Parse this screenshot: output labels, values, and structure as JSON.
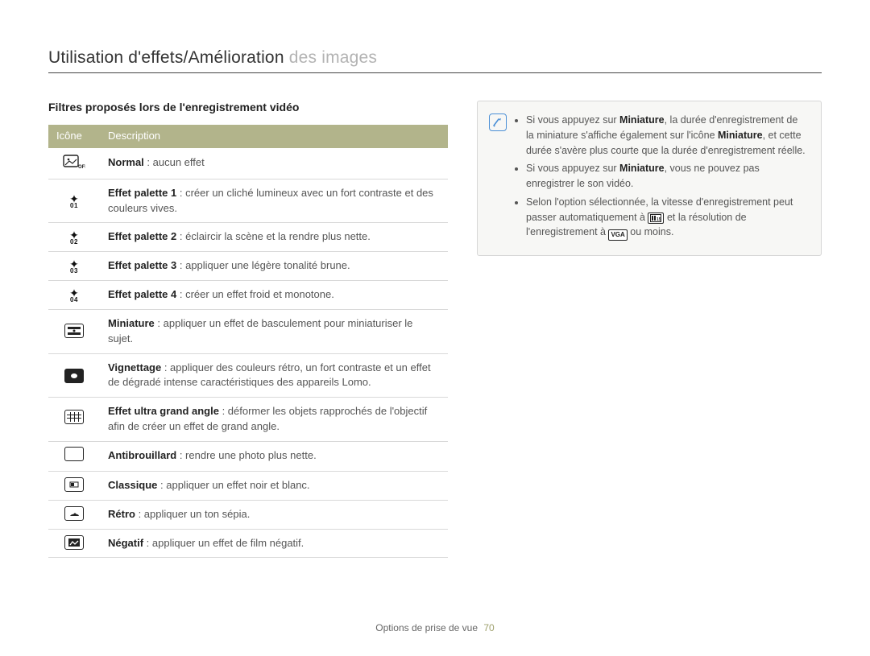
{
  "page_title": {
    "strong": "Utilisation d'effets/Amélioration ",
    "dim": "des images"
  },
  "section_heading": "Filtres proposés lors de l'enregistrement vidéo",
  "table_headers": {
    "icon": "Icône",
    "description": "Description"
  },
  "filters": [
    {
      "icon": "off",
      "bold": "Normal",
      "rest": " : aucun effet"
    },
    {
      "icon": "palette1",
      "bold": "Effet palette 1",
      "rest": " : créer un cliché lumineux avec un fort contraste et des couleurs vives."
    },
    {
      "icon": "palette2",
      "bold": "Effet palette 2",
      "rest": " : éclaircir la scène et la rendre plus nette."
    },
    {
      "icon": "palette3",
      "bold": "Effet palette 3",
      "rest": " : appliquer une légère tonalité brune."
    },
    {
      "icon": "palette4",
      "bold": "Effet palette 4",
      "rest": " : créer un effet froid et monotone."
    },
    {
      "icon": "miniature",
      "bold": "Miniature",
      "rest": " : appliquer un effet de basculement pour miniaturiser le sujet."
    },
    {
      "icon": "vignette",
      "bold": "Vignettage",
      "rest": " : appliquer des couleurs rétro, un fort contraste et un effet de dégradé intense caractéristiques des appareils Lomo."
    },
    {
      "icon": "fisheye",
      "bold": "Effet ultra grand angle",
      "rest": " : déformer les objets rapprochés de l'objectif afin de créer un effet de grand angle."
    },
    {
      "icon": "defog",
      "bold": "Antibrouillard",
      "rest": " : rendre une photo plus nette."
    },
    {
      "icon": "classic",
      "bold": "Classique",
      "rest": " : appliquer un effet noir et blanc."
    },
    {
      "icon": "retro",
      "bold": "Rétro",
      "rest": " : appliquer un ton sépia."
    },
    {
      "icon": "negative",
      "bold": "Négatif",
      "rest": " : appliquer un effet de film négatif."
    }
  ],
  "note": {
    "items": [
      {
        "parts": [
          {
            "t": "Si vous appuyez sur "
          },
          {
            "t": "Miniature",
            "b": true
          },
          {
            "t": ", la durée d'enregistrement de la miniature s'affiche également sur l'icône "
          },
          {
            "t": "Miniature",
            "b": true
          },
          {
            "t": ", et cette durée s'avère plus courte que la durée d'enregistrement réelle."
          }
        ]
      },
      {
        "parts": [
          {
            "t": "Si vous appuyez sur "
          },
          {
            "t": "Miniature",
            "b": true
          },
          {
            "t": ", vous ne pouvez pas enregistrer le son vidéo."
          }
        ]
      },
      {
        "parts": [
          {
            "t": "Selon l'option sélectionnée, la vitesse d'enregistrement peut passer automatiquement à "
          },
          {
            "badge": "fps"
          },
          {
            "t": " et la résolution de l'enregistrement à "
          },
          {
            "badge": "VGA"
          },
          {
            "t": " ou moins."
          }
        ]
      }
    ]
  },
  "footer": {
    "section": "Options de prise de vue",
    "page": "70"
  },
  "palette_labels": {
    "palette1": "01",
    "palette2": "02",
    "palette3": "03",
    "palette4": "04"
  }
}
